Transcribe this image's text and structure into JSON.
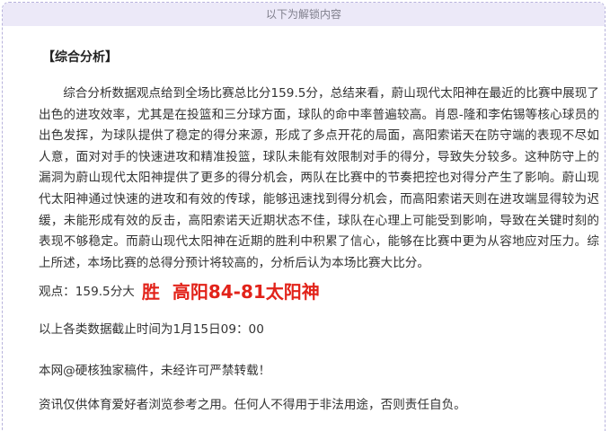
{
  "banner": {
    "text": "以下为解锁内容"
  },
  "article": {
    "section_title": "【综合分析】",
    "analysis": "综合分析数据观点给到全场比赛总比分159.5分，总结来看，蔚山现代太阳神在最近的比赛中展现了出色的进攻效率，尤其是在投篮和三分球方面，球队的命中率普遍较高。肖恩-隆和李佑锡等核心球员的出色发挥，为球队提供了稳定的得分来源，形成了多点开花的局面，高阳索诺天在防守端的表现不尽如人意，面对对手的快速进攻和精准投篮，球队未能有效限制对手的得分，导致失分较多。这种防守上的漏洞为蔚山现代太阳神提供了更多的得分机会，两队在比赛中的节奏把控也对得分产生了影响。蔚山现代太阳神通过快速的进攻和有效的传球，能够迅速找到得分机会，而高阳索诺天则在进攻端显得较为迟缓，未能形成有效的反击，高阳索诺天近期状态不佳，球队在心理上可能受到影响，导致在关键时刻的表现不够稳定。而蔚山现代太阳神在近期的胜利中积累了信心，能够在比赛中更为从容地应对压力。综上所述，本场比赛的总得分预计将较高的，分析后认为本场比赛大比分。",
    "verdict_label": "观点：159.5分大",
    "verdict_result": "胜  高阳84-81太阳神",
    "deadline": "以上各类数据截止时间为1月15日09：00",
    "copyright": "本网@硬核独家稿件，未经许可严禁转载！",
    "disclaimer": "资讯仅供体育爱好者浏览参考之用。任何人不得用于非法用途，否则责任自负。"
  },
  "colors": {
    "banner_bg": "#ece9f8",
    "border": "#b7b2dc",
    "highlight": "#e2231a",
    "text": "#333333"
  }
}
